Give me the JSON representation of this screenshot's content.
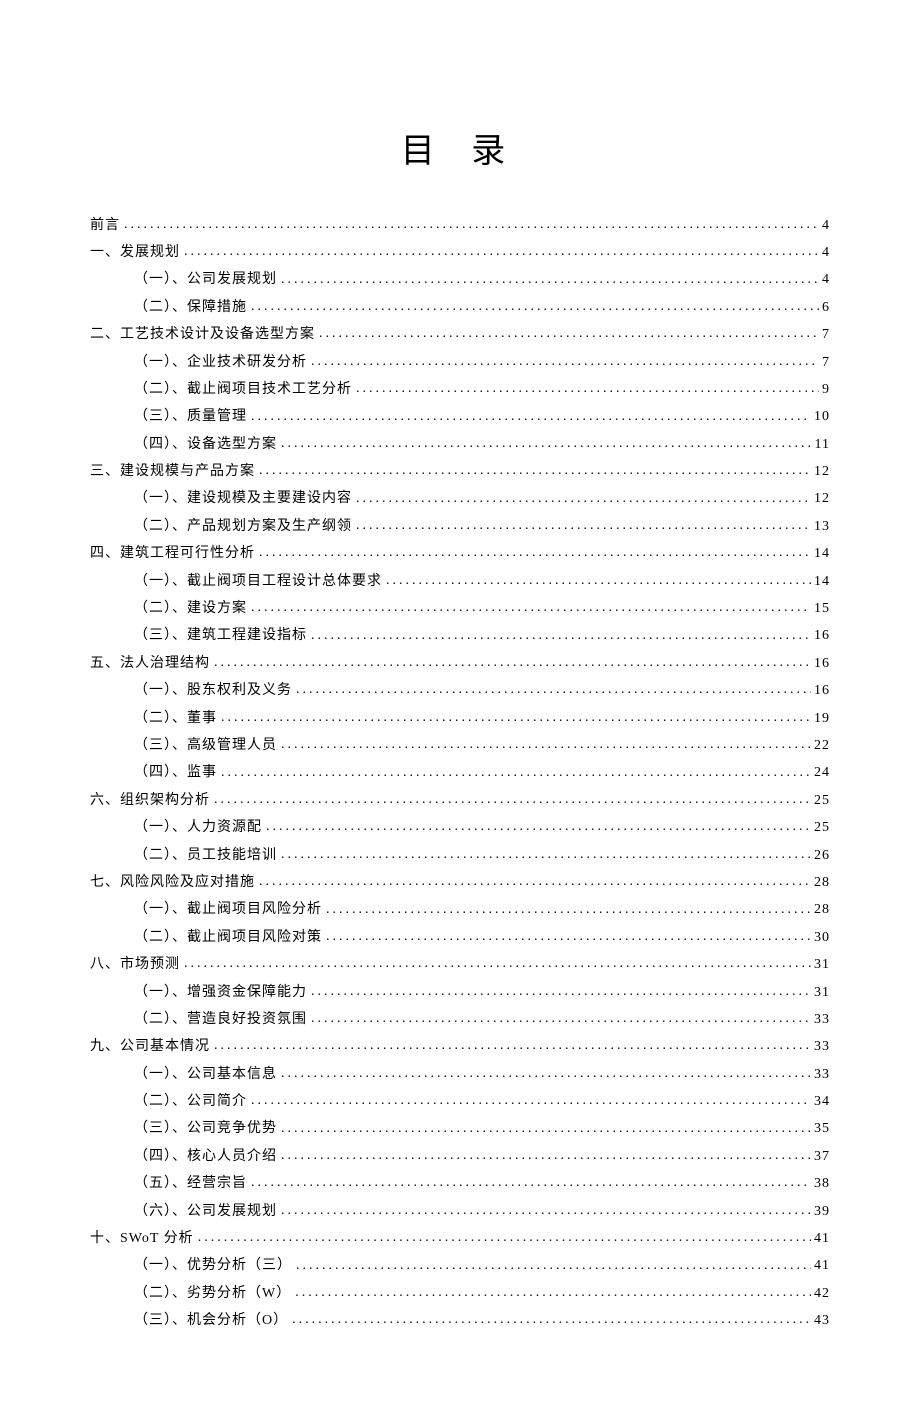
{
  "title": "目 录",
  "entries": [
    {
      "level": 1,
      "label": "前言",
      "page": "4"
    },
    {
      "level": 1,
      "label": "一、发展规划",
      "page": "4"
    },
    {
      "level": 2,
      "label": "（一）、公司发展规划",
      "page": "4"
    },
    {
      "level": 2,
      "label": "（二）、保障措施",
      "page": "6"
    },
    {
      "level": 1,
      "label": "二、工艺技术设计及设备选型方案",
      "page": "7"
    },
    {
      "level": 2,
      "label": "（一）、企业技术研发分析",
      "page": "7"
    },
    {
      "level": 2,
      "label": "（二）、截止阀项目技术工艺分析",
      "page": "9"
    },
    {
      "level": 2,
      "label": "（三）、质量管理",
      "page": "10"
    },
    {
      "level": 2,
      "label": "（四）、设备选型方案",
      "page": "11"
    },
    {
      "level": 1,
      "label": "三、建设规模与产品方案",
      "page": "12"
    },
    {
      "level": 2,
      "label": "（一）、建设规模及主要建设内容",
      "page": "12"
    },
    {
      "level": 2,
      "label": "（二）、产品规划方案及生产纲领",
      "page": "13"
    },
    {
      "level": 1,
      "label": "四、建筑工程可行性分析",
      "page": "14"
    },
    {
      "level": 2,
      "label": "（一）、截止阀项目工程设计总体要求",
      "page": "14"
    },
    {
      "level": 2,
      "label": "（二）、建设方案",
      "page": "15"
    },
    {
      "level": 2,
      "label": "（三）、建筑工程建设指标",
      "page": "16"
    },
    {
      "level": 1,
      "label": "五、法人治理结构",
      "page": "16"
    },
    {
      "level": 2,
      "label": "（一）、股东权利及义务",
      "page": "16"
    },
    {
      "level": 2,
      "label": "（二）、董事",
      "page": "19"
    },
    {
      "level": 2,
      "label": "（三）、高级管理人员",
      "page": "22"
    },
    {
      "level": 2,
      "label": "（四）、监事",
      "page": "24"
    },
    {
      "level": 1,
      "label": "六、组织架构分析",
      "page": "25"
    },
    {
      "level": 2,
      "label": "（一）、人力资源配",
      "page": "25"
    },
    {
      "level": 2,
      "label": "（二）、员工技能培训",
      "page": "26"
    },
    {
      "level": 1,
      "label": "七、风险风险及应对措施",
      "page": "28"
    },
    {
      "level": 2,
      "label": "（一）、截止阀项目风险分析",
      "page": "28"
    },
    {
      "level": 2,
      "label": "（二）、截止阀项目风险对策",
      "page": "30"
    },
    {
      "level": 1,
      "label": "八、市场预测",
      "page": "31"
    },
    {
      "level": 2,
      "label": "（一）、增强资金保障能力",
      "page": "31"
    },
    {
      "level": 2,
      "label": "（二）、营造良好投资氛围",
      "page": "33"
    },
    {
      "level": 1,
      "label": "九、公司基本情况",
      "page": "33"
    },
    {
      "level": 2,
      "label": "（一）、公司基本信息",
      "page": "33"
    },
    {
      "level": 2,
      "label": "（二）、公司简介",
      "page": "34"
    },
    {
      "level": 2,
      "label": "（三）、公司竞争优势",
      "page": "35"
    },
    {
      "level": 2,
      "label": "（四）、核心人员介绍",
      "page": "37"
    },
    {
      "level": 2,
      "label": "（五）、经营宗旨",
      "page": "38"
    },
    {
      "level": 2,
      "label": "（六）、公司发展规划",
      "page": "39"
    },
    {
      "level": 1,
      "label": "十、SWoT 分析",
      "page": "41"
    },
    {
      "level": 2,
      "label": "（一）、优势分析（三）",
      "page": "41"
    },
    {
      "level": 2,
      "label": "（二）、劣势分析（W）",
      "page": "42"
    },
    {
      "level": 2,
      "label": "（三）、机会分析（O）",
      "page": "43"
    }
  ]
}
